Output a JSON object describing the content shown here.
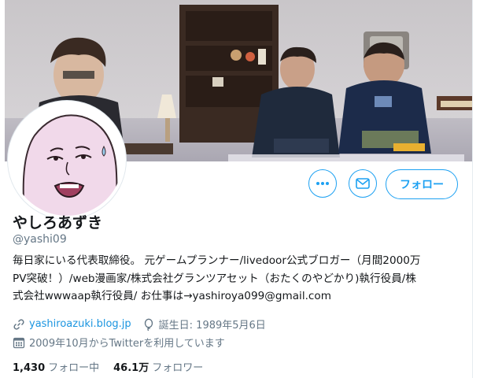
{
  "profile": {
    "display_name": "やしろあずき",
    "handle": "@yashi09",
    "bio_lines": [
      "毎日家にいる代表取締役。 元ゲームプランナー/livedoor公式ブロガー（月間2000万",
      "PV突破！）/web漫画家/株式会社グランツアセット（おたくのやどかり)執行役員/株",
      "式会社wwwaap執行役員/ お仕事は→yashiroya099@gmail.com"
    ],
    "website": "yashiroazuki.blog.jp",
    "birthday": "誕生日: 1989年5月6日",
    "joined": "2009年10月からTwitterを利用しています"
  },
  "actions": {
    "more_icon": "more-dots-icon",
    "message_icon": "envelope-icon",
    "follow_label": "フォロー"
  },
  "stats": {
    "following_count": "1,430",
    "following_label": "フォロー中",
    "followers_count": "46.1万",
    "followers_label": "フォロワー"
  },
  "colors": {
    "accent": "#1da1f2",
    "link": "#1b95e0",
    "secondary_text": "#657786"
  }
}
